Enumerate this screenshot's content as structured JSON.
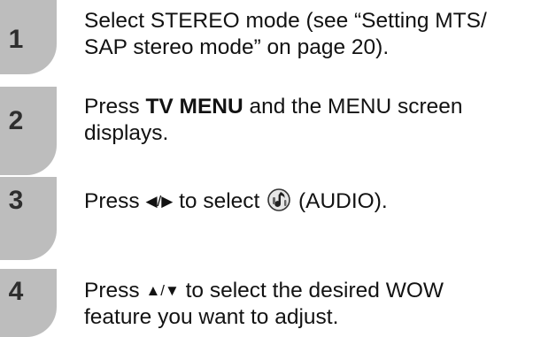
{
  "steps": [
    {
      "number": "1",
      "line1": "Select STEREO mode (see “Setting MTS/",
      "line2": "SAP stereo mode” on page 20)."
    },
    {
      "number": "2",
      "pre": "Press ",
      "bold": "TV MENU",
      "post": " and the MENU screen",
      "line2": "displays."
    },
    {
      "number": "3",
      "pre": "Press ",
      "arrows": "◀/▶",
      "mid": " to select ",
      "icon": "audio-icon",
      "post": " (AUDIO)."
    },
    {
      "number": "4",
      "pre": "Press ",
      "arrows": "▲/▼",
      "post": " to select the desired WOW",
      "line2": "feature you want to adjust."
    }
  ]
}
